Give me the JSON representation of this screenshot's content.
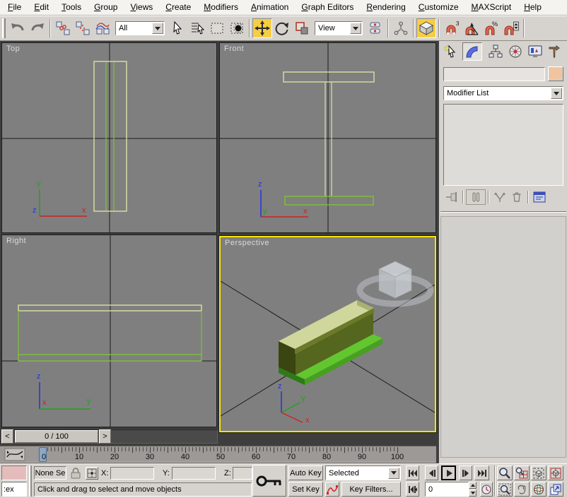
{
  "colors": {
    "active_viewport_border": "#F7E609",
    "toolbar_active_bg": "#F6CE46",
    "viewport_bg": "#7F7F7F",
    "object_swatch": "#F0C49E",
    "beam_top": "#D0D79C",
    "beam_top_side": "#6B7A28",
    "beam_web": "#55661E",
    "beam_end": "#3A4512",
    "beam_flange": "#62C72E",
    "beam_flange_side": "#47A021",
    "wire_khaki": "#DCE0A2",
    "wire_green": "#7EC234",
    "axis_x": "#CC2222",
    "axis_y": "#1FA31F",
    "axis_z": "#2233DD"
  },
  "menu": {
    "items": [
      "File",
      "Edit",
      "Tools",
      "Group",
      "Views",
      "Create",
      "Modifiers",
      "Animation",
      "Graph Editors",
      "Rendering",
      "Customize",
      "MAXScript",
      "Help"
    ]
  },
  "toolbar": {
    "selection_filter": "All",
    "coordinate_system": "View",
    "snap_count_label": "3",
    "percent_label": "%"
  },
  "viewports": {
    "top": {
      "label": "Top"
    },
    "front": {
      "label": "Front"
    },
    "right": {
      "label": "Right"
    },
    "perspective": {
      "label": "Perspective"
    },
    "axis": {
      "x": "x",
      "y": "y",
      "z": "z"
    }
  },
  "command_panel": {
    "object_name": "",
    "modifier_list": "Modifier List"
  },
  "timeline": {
    "frame_display": "0 / 100",
    "prev": "<",
    "next": ">"
  },
  "trackbar": {
    "numbers": [
      "0",
      "10",
      "20",
      "30",
      "40",
      "50",
      "60",
      "70",
      "80",
      "90",
      "100"
    ]
  },
  "status_bar": {
    "listener_text": ":ex",
    "selection_status": "None Se",
    "x_label": "X:",
    "y_label": "Y:",
    "z_label": "Z:",
    "x_value": "",
    "y_value": "",
    "z_value": "",
    "prompt": "Click and drag to select and move objects",
    "auto_key": "Auto Key",
    "set_key": "Set Key",
    "key_mode": "Selected",
    "key_filters": "Key Filters...",
    "frame": "0"
  }
}
